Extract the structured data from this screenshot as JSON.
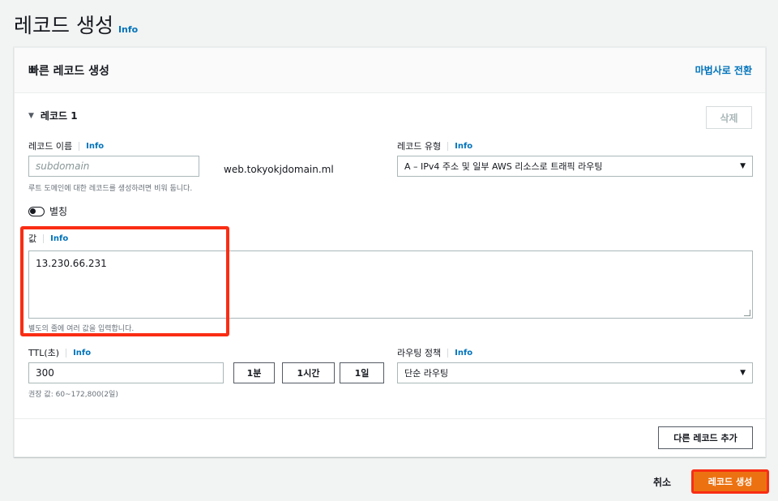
{
  "page": {
    "title": "레코드 생성",
    "info": "Info"
  },
  "panel": {
    "title": "빠른 레코드 생성",
    "switch_link": "마법사로 전환",
    "record_header": "레코드 1",
    "delete_label": "삭제",
    "record_name": {
      "label": "레코드 이름",
      "info": "Info",
      "placeholder": "subdomain",
      "suffix": "web.tokyokjdomain.ml",
      "hint": "루트 도메인에 대한 레코드를 생성하려면 비워 둡니다."
    },
    "record_type": {
      "label": "레코드 유형",
      "info": "Info",
      "value": "A – IPv4 주소 및 일부 AWS 리소스로 트래픽 라우팅"
    },
    "alias": {
      "label": "별칭",
      "enabled": false
    },
    "value": {
      "label": "값",
      "info": "Info",
      "content": "13.230.66.231",
      "hint": "별도의 줄에 여러 값을 입력합니다."
    },
    "ttl": {
      "label": "TTL(초)",
      "info": "Info",
      "value": "300",
      "preset_1m": "1분",
      "preset_1h": "1시간",
      "preset_1d": "1일",
      "hint": "권장 값: 60~172,800(2일)"
    },
    "routing_policy": {
      "label": "라우팅 정책",
      "info": "Info",
      "value": "단순 라우팅"
    },
    "add_record_label": "다른 레코드 추가"
  },
  "footer": {
    "cancel_label": "취소",
    "create_label": "레코드 생성"
  },
  "colors": {
    "accent_orange": "#ec7211",
    "highlight_red": "#f92d14",
    "link_blue": "#0073bb"
  }
}
